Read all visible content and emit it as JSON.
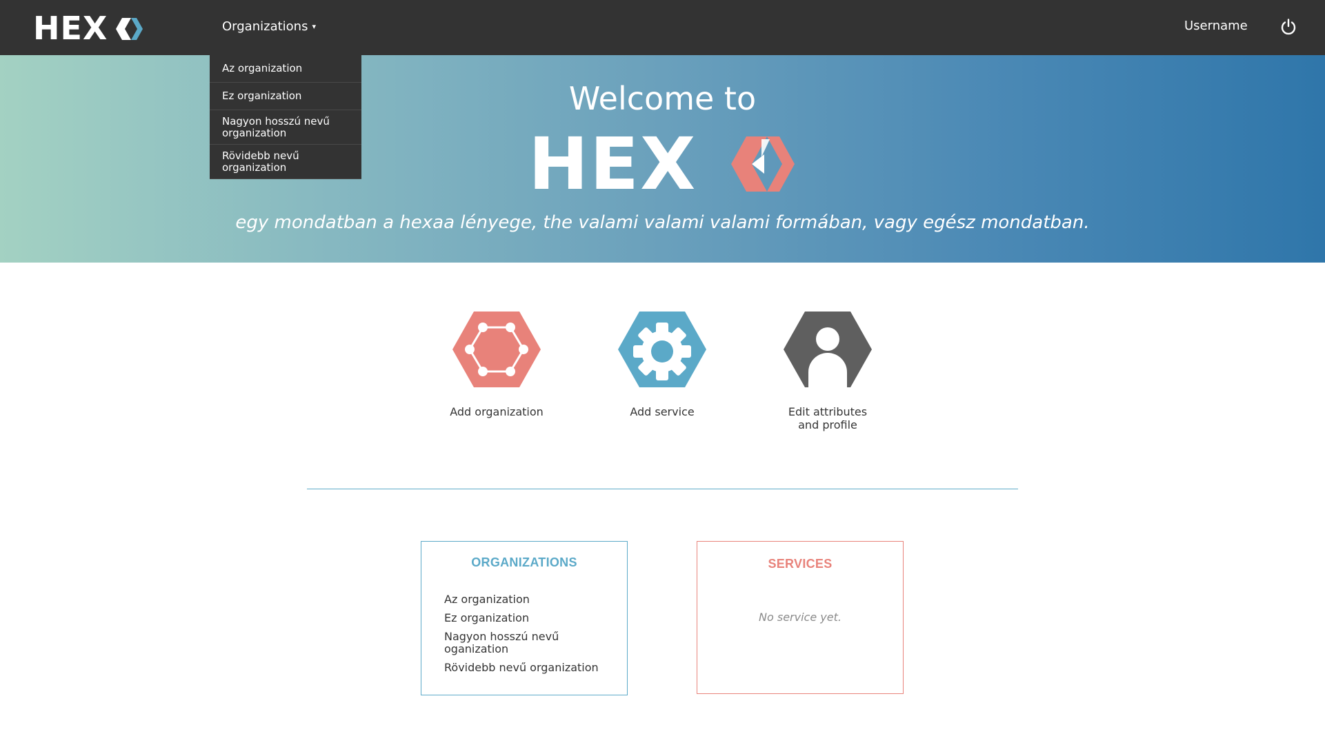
{
  "colors": {
    "nav_bg": "#333333",
    "teal": "#5ba9c8",
    "coral": "#e8827a",
    "gray": "#5f5f5f"
  },
  "nav": {
    "brand": "HEXAA",
    "brand_prefix": "HEX",
    "organizations_label": "Organizations",
    "username": "Username",
    "power_icon": "power-icon"
  },
  "dropdown": {
    "items": [
      "Az organization",
      "Ez organization",
      "Nagyon hosszú nevű organization",
      "Rövidebb nevű organization"
    ]
  },
  "hero": {
    "title": "Welcome to",
    "logo_prefix": "HEX",
    "tagline": "egy mondatban a hexaa lényege, the valami valami valami formában, vagy egész mondatban."
  },
  "actions": [
    {
      "label": "Add organization",
      "icon": "network-hexagon-icon"
    },
    {
      "label": "Add service",
      "icon": "gear-hexagon-icon"
    },
    {
      "label": "Edit attributes and profile",
      "icon": "user-hexagon-icon"
    }
  ],
  "organizations_panel": {
    "title": "ORGANIZATIONS",
    "items": [
      "Az organization",
      "Ez organization",
      "Nagyon hosszú nevű oganization",
      "Rövidebb nevű organization"
    ]
  },
  "services_panel": {
    "title": "SERVICES",
    "empty_text": "No service yet."
  }
}
